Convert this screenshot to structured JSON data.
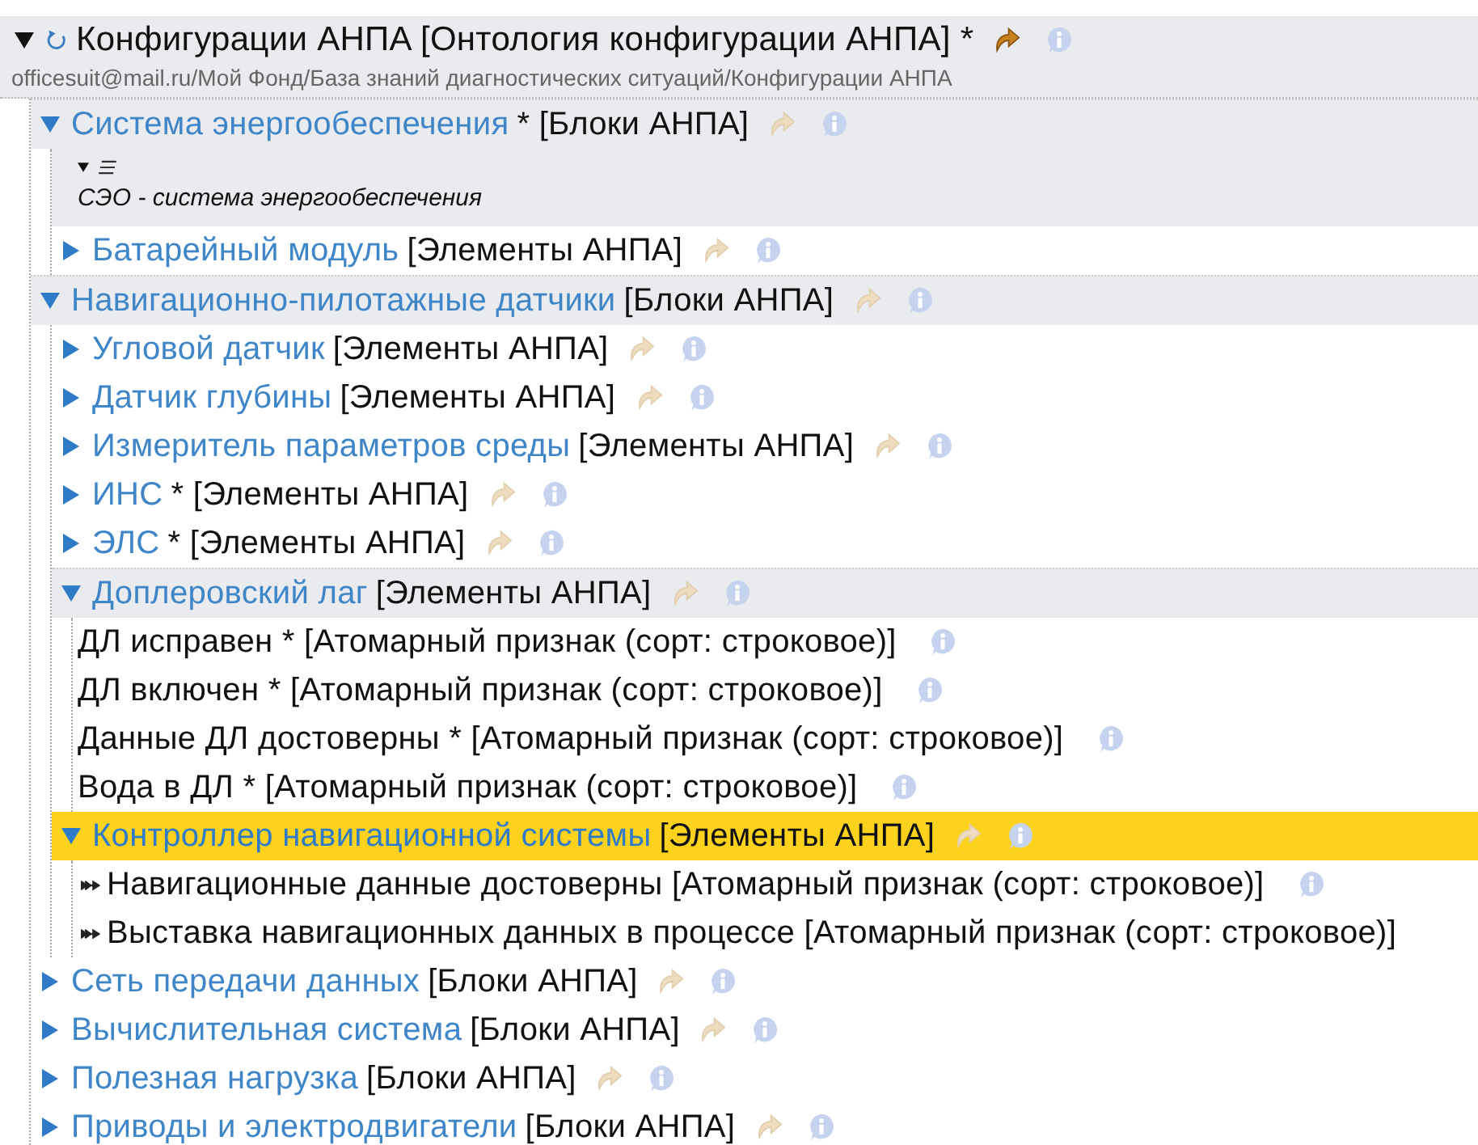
{
  "root": {
    "title": "Конфигурации АНПА",
    "type": "[Онтология конфигурации АНПА] *",
    "expanded": true,
    "link_active": true,
    "info": true,
    "path": "officesuit@mail.ru/Мой Фонд/База знаний диагностических ситуаций/Конфигурации АНПА",
    "children": [
      {
        "kind": "node",
        "name": "Система энергообеспечения",
        "type": "* [Блоки АНПА]",
        "expanded": true,
        "selected": false,
        "info": true,
        "children": [
          {
            "kind": "note",
            "expanded": true,
            "text": "СЭО - система энергообеспечения"
          },
          {
            "kind": "node",
            "name": "Батарейный модуль",
            "type": "[Элементы АНПА]",
            "expanded": false,
            "selected": false,
            "info": true
          }
        ]
      },
      {
        "kind": "node",
        "name": "Навигационно-пилотажные датчики",
        "type": "[Блоки АНПА]",
        "expanded": true,
        "selected": false,
        "info": true,
        "children": [
          {
            "kind": "node",
            "name": "Угловой датчик",
            "type": "[Элементы АНПА]",
            "expanded": false,
            "selected": false,
            "info": true
          },
          {
            "kind": "node",
            "name": "Датчик глубины",
            "type": "[Элементы АНПА]",
            "expanded": false,
            "selected": false,
            "info": true
          },
          {
            "kind": "node",
            "name": "Измеритель параметров среды",
            "type": "[Элементы АНПА]",
            "expanded": false,
            "selected": false,
            "info": true
          },
          {
            "kind": "node",
            "name": "ИНС",
            "type": "* [Элементы АНПА]",
            "expanded": false,
            "selected": false,
            "info": true
          },
          {
            "kind": "node",
            "name": "ЭЛС",
            "type": "* [Элементы АНПА]",
            "expanded": false,
            "selected": false,
            "info": true
          },
          {
            "kind": "node",
            "name": "Доплеровский лаг",
            "type": "[Элементы АНПА]",
            "expanded": true,
            "selected": false,
            "info": true,
            "children": [
              {
                "kind": "attribute",
                "text": "ДЛ исправен * [Атомарный признак (сорт: строковое)]",
                "info": true
              },
              {
                "kind": "attribute",
                "text": "ДЛ включен * [Атомарный признак (сорт: строковое)]",
                "info": true
              },
              {
                "kind": "attribute",
                "text": "Данные ДЛ достоверны * [Атомарный признак (сорт: строковое)]",
                "info": true
              },
              {
                "kind": "attribute",
                "text": "Вода в ДЛ * [Атомарный признак (сорт: строковое)]",
                "info": true
              }
            ]
          },
          {
            "kind": "node",
            "name": "Контроллер навигационной системы",
            "type": "[Элементы АНПА]",
            "expanded": true,
            "selected": true,
            "info": true,
            "children": [
              {
                "kind": "relation",
                "text": "Навигационные данные достоверны [Атомарный признак (сорт: строковое)]",
                "info": true
              },
              {
                "kind": "relation",
                "text": "Выставка навигационных данных в процессе [Атомарный признак (сорт: строковое)]",
                "info": false
              }
            ]
          }
        ]
      },
      {
        "kind": "node",
        "name": "Сеть передачи данных",
        "type": "[Блоки АНПА]",
        "expanded": false,
        "selected": false,
        "info": true
      },
      {
        "kind": "node",
        "name": "Вычислительная система",
        "type": "[Блоки АНПА]",
        "expanded": false,
        "selected": false,
        "info": true
      },
      {
        "kind": "node",
        "name": "Полезная нагрузка",
        "type": "[Блоки АНПА]",
        "expanded": false,
        "selected": false,
        "info": true
      },
      {
        "kind": "node",
        "name": "Приводы и электродвигатели",
        "type": "[Блоки АНПА]",
        "expanded": false,
        "selected": false,
        "info": true
      }
    ]
  }
}
